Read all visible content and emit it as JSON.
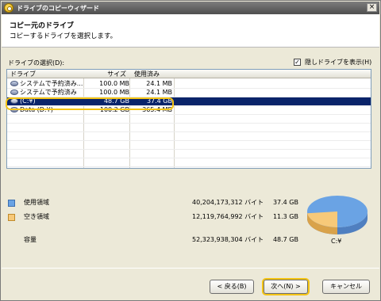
{
  "window": {
    "title": "ドライブのコピーウィザード",
    "close_label": "×"
  },
  "header": {
    "title": "コピー元のドライブ",
    "subtitle": "コピーするドライブを選択します。"
  },
  "drive_selection": {
    "label": "ドライブの選択(D):",
    "show_hidden_label": "隠しドライブを表示(H)",
    "show_hidden_checked": true,
    "columns": [
      "ドライブ",
      "サイズ",
      "使用済み"
    ],
    "rows": [
      {
        "name": "システムで予約済み...",
        "size": "100.0 MB",
        "used": "24.1 MB",
        "selected": false
      },
      {
        "name": "システムで予約済み",
        "size": "100.0 MB",
        "used": "24.1 MB",
        "selected": false
      },
      {
        "name": "(C:¥)",
        "size": "48.7 GB",
        "used": "37.4 GB",
        "selected": true
      },
      {
        "name": "Data (D:¥)",
        "size": "100.2 GB",
        "used": "365.4 MB",
        "selected": false
      }
    ]
  },
  "usage": {
    "used": {
      "label": "使用領域",
      "bytes": "40,204,173,312 バイト",
      "gb": "37.4 GB",
      "color": "#6aa3e4"
    },
    "free": {
      "label": "空き領域",
      "bytes": "12,119,764,992 バイト",
      "gb": "11.3 GB",
      "color": "#f7c979"
    },
    "capacity": {
      "label": "容量",
      "bytes": "52,323,938,304 バイト",
      "gb": "48.7 GB"
    },
    "pie_used_fraction": 0.768,
    "drive_caption": "C:¥"
  },
  "buttons": {
    "back": "< 戻る(B)",
    "next": "次へ(N) >",
    "cancel": "キャンセル"
  }
}
